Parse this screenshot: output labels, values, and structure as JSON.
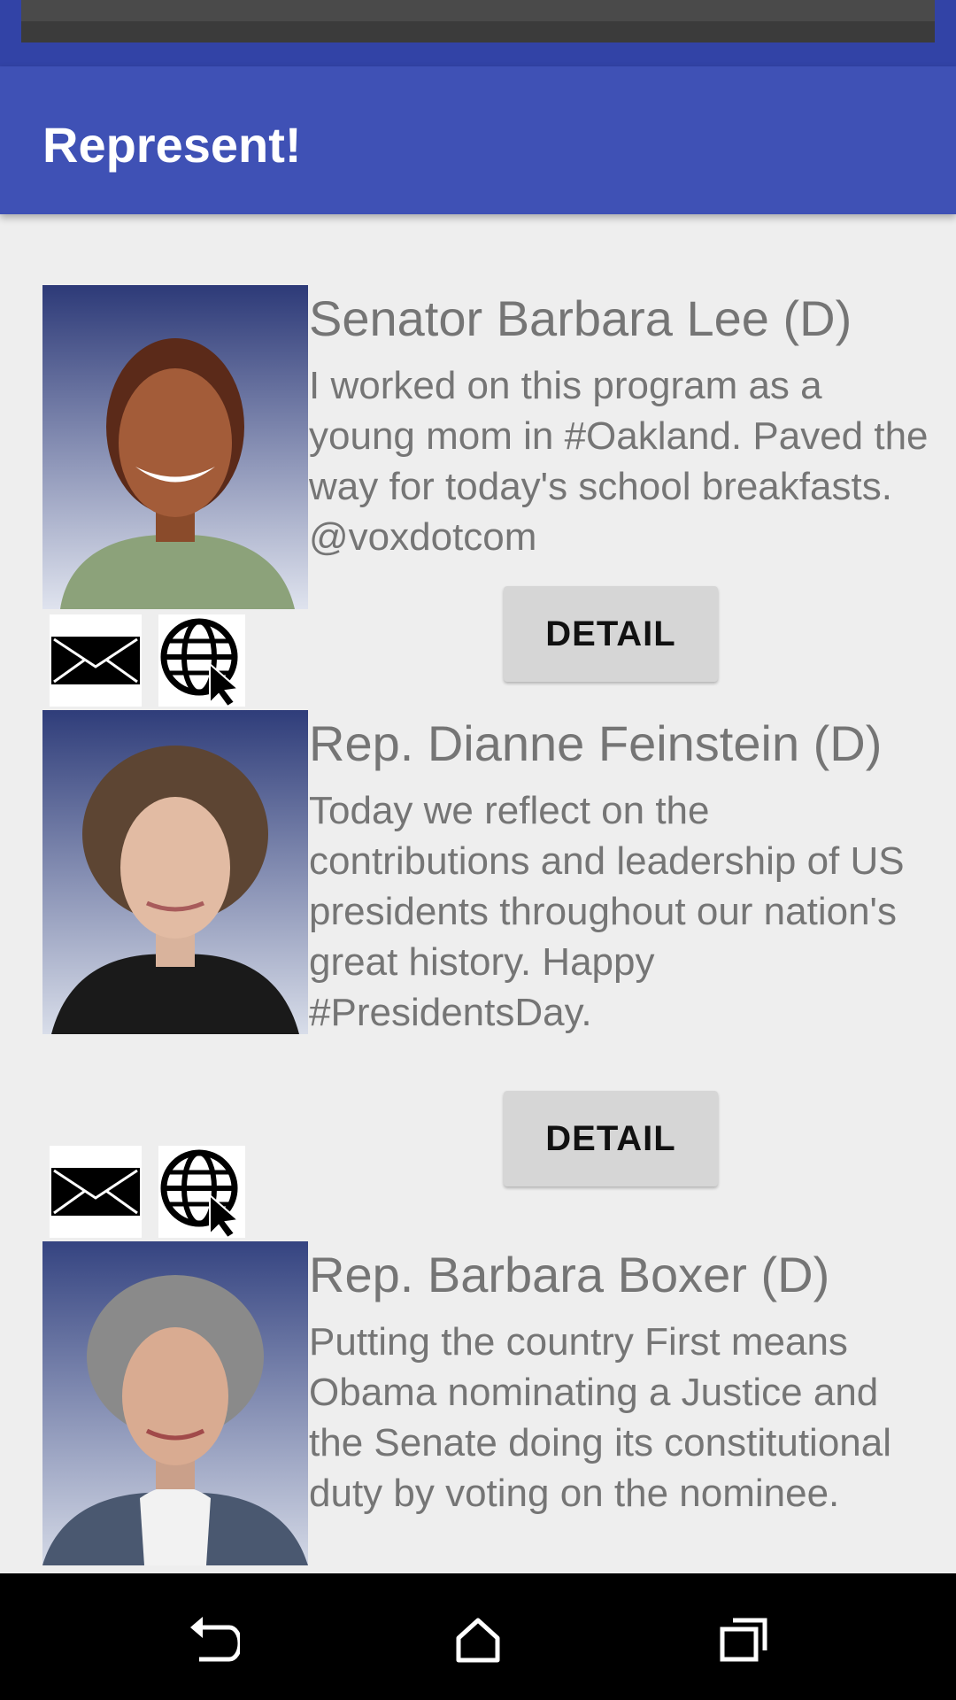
{
  "app": {
    "title": "Represent!"
  },
  "colors": {
    "primary": "#3f51b5",
    "primary_dark": "#3243a6",
    "background": "#eeeeee",
    "text_secondary": "#757575",
    "button": "#d6d6d6"
  },
  "representatives": [
    {
      "name": "Senator Barbara Lee (D)",
      "tweet": "I worked on this program as a young mom in #Oakland. Paved the way for today's school breakfasts. @voxdotcom",
      "detail_label": "DETAIL",
      "icons": [
        "email-icon",
        "website-icon"
      ]
    },
    {
      "name": "Rep. Dianne Feinstein (D)",
      "tweet": "Today we reflect on the contributions and leadership of US presidents throughout our nation's great history. Happy #PresidentsDay.",
      "detail_label": "DETAIL",
      "icons": [
        "email-icon",
        "website-icon"
      ]
    },
    {
      "name": "Rep. Barbara Boxer (D)",
      "tweet": "Putting the country First means Obama nominating a Justice and the Senate doing its constitutional duty by voting on the nominee."
    }
  ],
  "nav": {
    "back": "back-icon",
    "home": "home-icon",
    "recents": "recents-icon"
  }
}
